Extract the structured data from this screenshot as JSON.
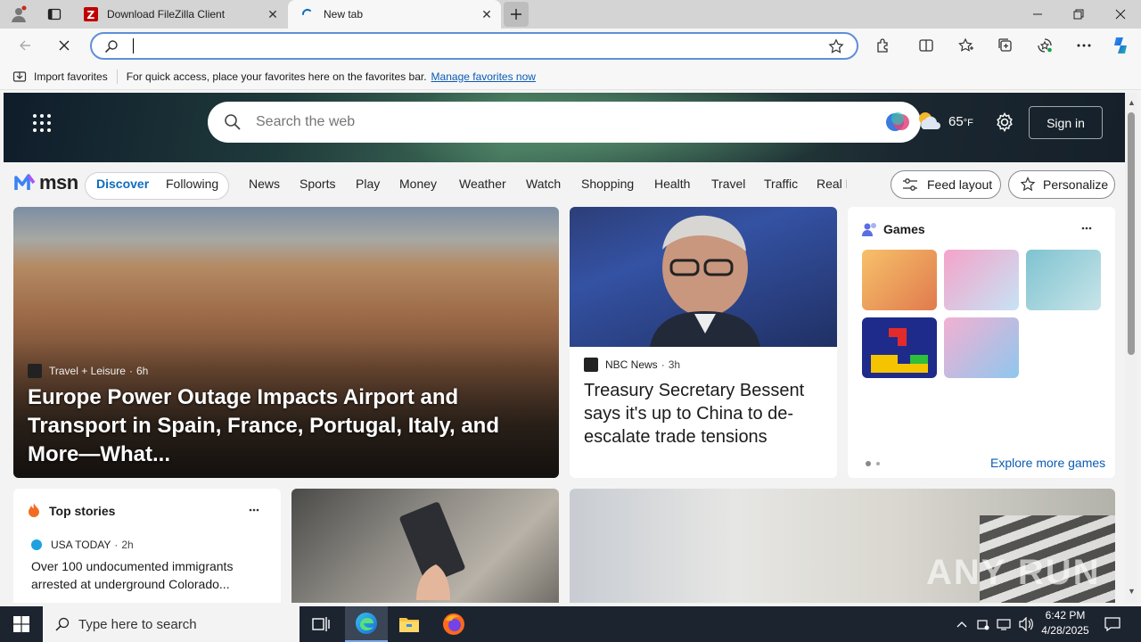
{
  "tabs": [
    {
      "title": "Download FileZilla Client",
      "active": false
    },
    {
      "title": "New tab",
      "active": true
    }
  ],
  "address": {
    "value": "",
    "placeholder": ""
  },
  "favorites_bar": {
    "import_label": "Import favorites",
    "message": "For quick access, place your favorites here on the favorites bar.",
    "manage_link": "Manage favorites now"
  },
  "msn": {
    "search_placeholder": "Search the web",
    "temperature": "65",
    "temp_unit": "°F",
    "sign_in": "Sign in",
    "logo_text": "msn",
    "feed_tabs": [
      "Discover",
      "Following"
    ],
    "nav_links": [
      "News",
      "Sports",
      "Play",
      "Money",
      "Weather",
      "Watch",
      "Shopping",
      "Health",
      "Travel",
      "Traffic",
      "Real E"
    ],
    "feed_layout_label": "Feed layout",
    "personalize_label": "Personalize",
    "hero_story": {
      "source": "Travel + Leisure",
      "age": "6h",
      "headline": "Europe Power Outage Impacts Airport and Transport in Spain, France, Portugal, Italy, and More—What..."
    },
    "side_story": {
      "source": "NBC News",
      "age": "3h",
      "headline": "Treasury Secretary Bessent says it's up to China to de-escalate trade tensions"
    },
    "games": {
      "title": "Games",
      "explore": "Explore more games"
    },
    "top_stories": {
      "title": "Top stories",
      "source": "USA TODAY",
      "age": "2h",
      "headline": "Over 100 undocumented immigrants arrested at underground Colorado..."
    },
    "watermark": "ANY RUN"
  },
  "taskbar": {
    "search_placeholder": "Type here to search",
    "time": "6:42 PM",
    "date": "4/28/2025"
  },
  "colors": {
    "accent": "#0f6cbd",
    "link": "#0b5bb5",
    "taskbar": "#1c2430"
  }
}
